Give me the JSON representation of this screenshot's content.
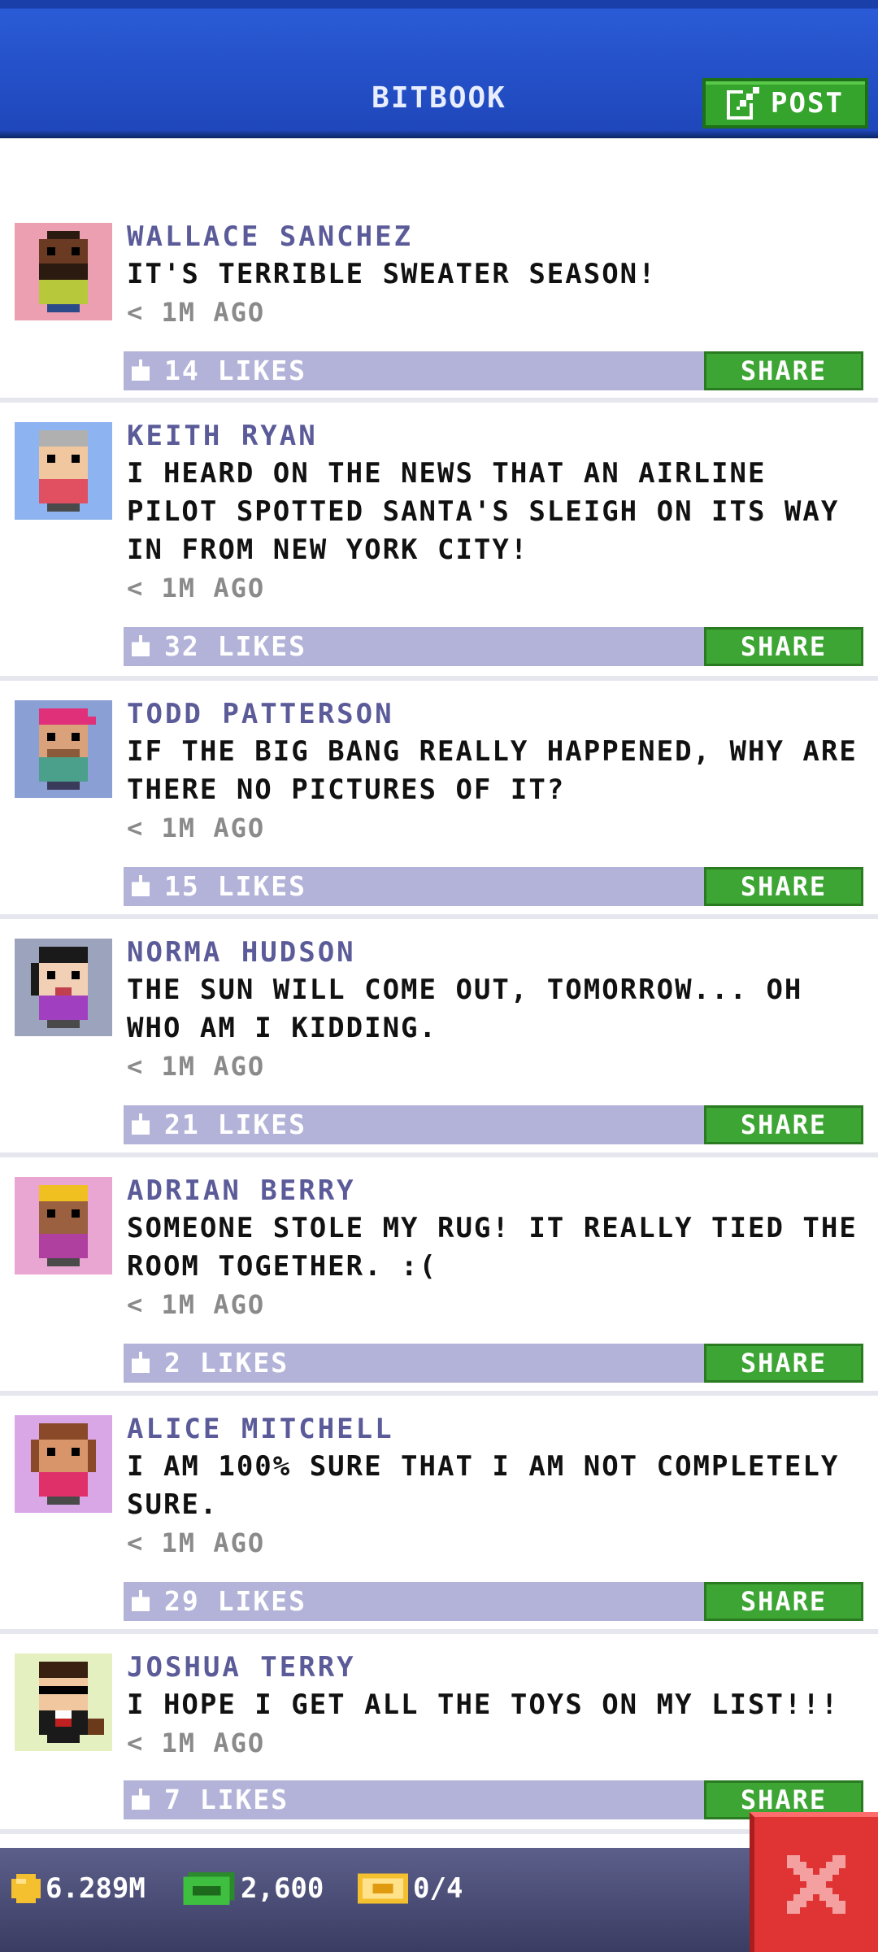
{
  "header": {
    "title": "BITBOOK",
    "post_label": "POST"
  },
  "posts": [
    {
      "author": "WALLACE SANCHEZ",
      "text": "IT'S TERRIBLE SWEATER SEASON!",
      "time": "< 1M AGO",
      "likes": "14 LIKES",
      "share": "SHARE",
      "avatar_bg": "#eb9fb0"
    },
    {
      "author": "KEITH RYAN",
      "text": "I HEARD ON THE NEWS THAT AN AIRLINE PILOT SPOTTED SANTA'S SLEIGH ON ITS WAY IN FROM NEW YORK CITY!",
      "time": "< 1M AGO",
      "likes": "32 LIKES",
      "share": "SHARE",
      "avatar_bg": "#8db4f0"
    },
    {
      "author": "TODD PATTERSON",
      "text": "IF THE BIG BANG REALLY HAPPENED, WHY ARE THERE NO PICTURES OF IT?",
      "time": "< 1M AGO",
      "likes": "15 LIKES",
      "share": "SHARE",
      "avatar_bg": "#8aa0d4"
    },
    {
      "author": "NORMA HUDSON",
      "text": "THE SUN WILL COME OUT, TOMORROW... OH WHO AM I KIDDING.",
      "time": "< 1M AGO",
      "likes": "21 LIKES",
      "share": "SHARE",
      "avatar_bg": "#9ca3bd"
    },
    {
      "author": "ADRIAN BERRY",
      "text": "SOMEONE STOLE MY RUG! IT REALLY TIED THE ROOM TOGETHER. :(",
      "time": "< 1M AGO",
      "likes": "2 LIKES",
      "share": "SHARE",
      "avatar_bg": "#e9a6d2"
    },
    {
      "author": "ALICE MITCHELL",
      "text": "I AM 100% SURE THAT I AM NOT COMPLETELY SURE.",
      "time": "< 1M AGO",
      "likes": "29 LIKES",
      "share": "SHARE",
      "avatar_bg": "#d9a6e6"
    },
    {
      "author": "JOSHUA TERRY",
      "text": "I HOPE I GET ALL THE TOYS ON MY LIST!!!",
      "time": "< 1M AGO",
      "likes": "7 LIKES",
      "share": "SHARE",
      "avatar_bg": "#e5f0c0"
    }
  ],
  "status_bar": {
    "coins": "6.289M",
    "bux": "2,600",
    "tickets": "0/4"
  },
  "colors": {
    "accent_green": "#35a42c",
    "header_blue": "#2a5bd6",
    "close_red": "#e03434"
  },
  "icons": {
    "post": "edit-icon",
    "like": "thumb-up-icon",
    "coins": "coin-icon",
    "bux": "cash-icon",
    "tickets": "ticket-icon",
    "close": "close-icon"
  }
}
